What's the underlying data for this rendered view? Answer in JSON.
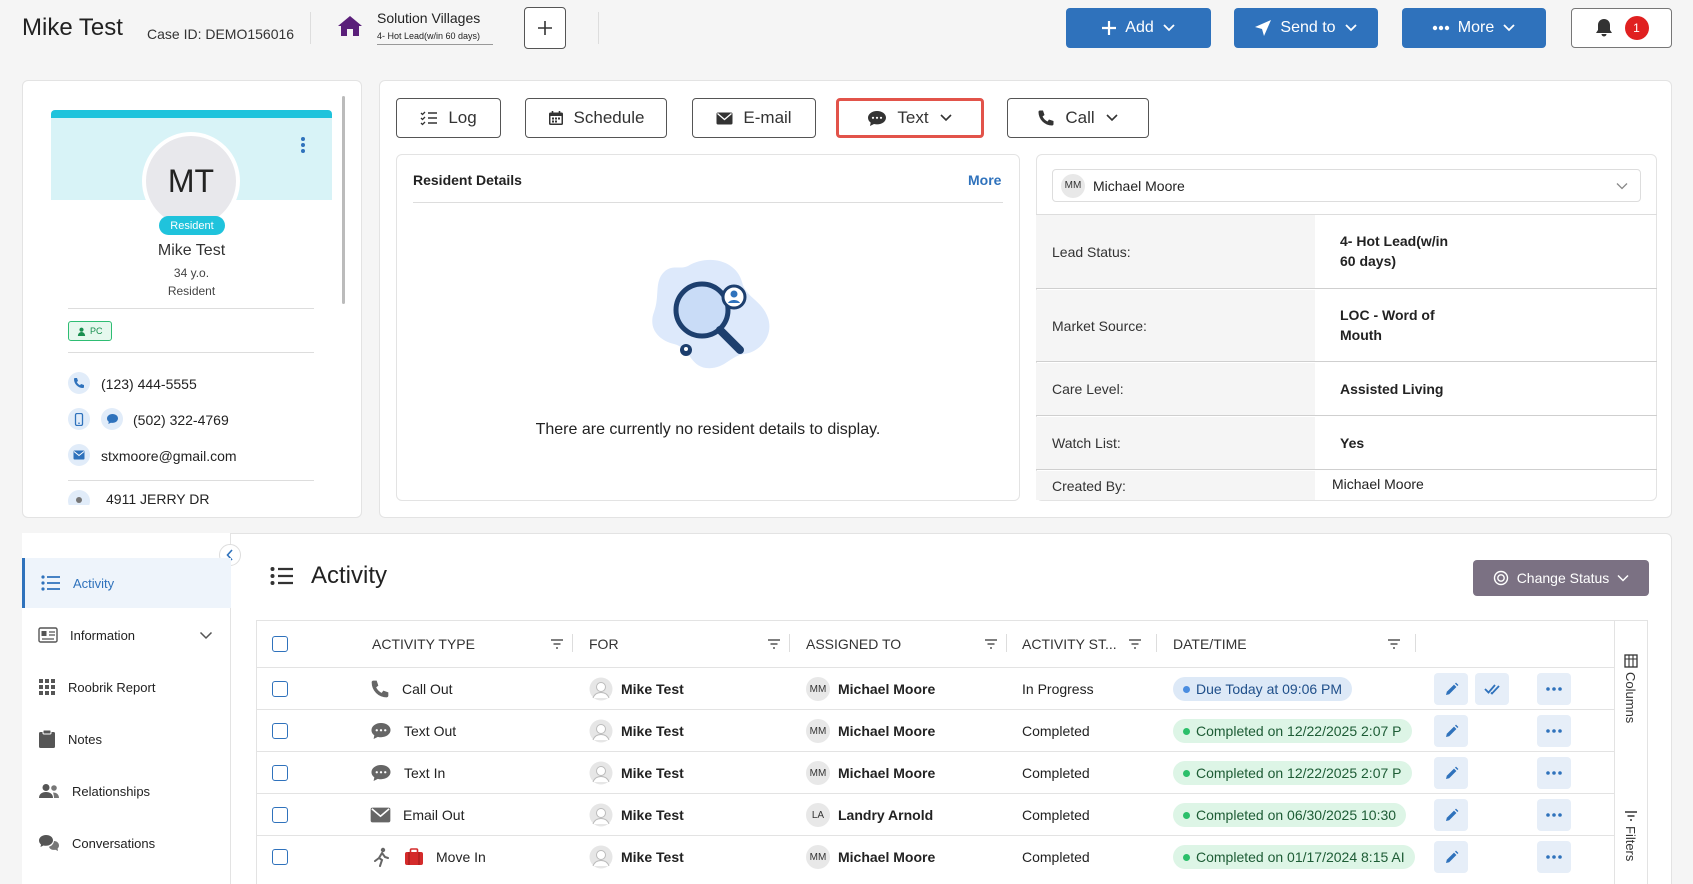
{
  "header": {
    "title": "Mike Test",
    "case_id": "Case ID: DEMO156016",
    "community_name": "Solution Villages",
    "community_status": "4- Hot Lead(w/in 60 days)",
    "add_label": "Add",
    "send_label": "Send to",
    "more_label": "More",
    "notification_count": "1"
  },
  "profile": {
    "initials": "MT",
    "badge": "Resident",
    "name": "Mike Test",
    "age": "34 y.o.",
    "role": "Resident",
    "tag": "PC",
    "phone": "(123) 444-5555",
    "mobile": "(502) 322-4769",
    "email": "stxmoore@gmail.com",
    "address": "4911 JERRY DR"
  },
  "actions": {
    "log": "Log",
    "schedule": "Schedule",
    "email": "E-mail",
    "text": "Text",
    "call": "Call"
  },
  "resident_details": {
    "title": "Resident Details",
    "more": "More",
    "empty": "There are currently no resident details to display."
  },
  "lead": {
    "user_initials": "MM",
    "user_name": "Michael Moore",
    "rows": [
      {
        "label": "Lead Status:",
        "value_line1": "4- Hot Lead(w/in",
        "value_line2": "60 days)"
      },
      {
        "label": "Market Source:",
        "value_line1": "LOC - Word of",
        "value_line2": "Mouth"
      },
      {
        "label": "Care Level:",
        "value_line1": "Assisted Living",
        "value_line2": ""
      },
      {
        "label": "Watch List:",
        "value_line1": "Yes",
        "value_line2": ""
      },
      {
        "label": "Created By:",
        "value_line1": "Michael Moore",
        "value_line2": ""
      }
    ]
  },
  "nav": {
    "items": [
      {
        "label": "Activity"
      },
      {
        "label": "Information"
      },
      {
        "label": "Roobrik Report"
      },
      {
        "label": "Notes"
      },
      {
        "label": "Relationships"
      },
      {
        "label": "Conversations"
      }
    ]
  },
  "activity": {
    "title": "Activity",
    "change_status": "Change Status",
    "columns": [
      "ACTIVITY TYPE",
      "FOR",
      "ASSIGNED TO",
      "ACTIVITY ST...",
      "DATE/TIME"
    ],
    "side_columns": "Columns",
    "side_filters": "Filters",
    "rows": [
      {
        "type": "Call Out",
        "for": "Mike Test",
        "assigned_initials": "MM",
        "assigned": "Michael Moore",
        "status": "In Progress",
        "date": "Due Today at 09:06 PM",
        "pill": "blue"
      },
      {
        "type": "Text Out",
        "for": "Mike Test",
        "assigned_initials": "MM",
        "assigned": "Michael Moore",
        "status": "Completed",
        "date": "Completed on 12/22/2025 2:07 P",
        "pill": "green"
      },
      {
        "type": "Text In",
        "for": "Mike Test",
        "assigned_initials": "MM",
        "assigned": "Michael Moore",
        "status": "Completed",
        "date": "Completed on 12/22/2025 2:07 P",
        "pill": "green"
      },
      {
        "type": "Email Out",
        "for": "Mike Test",
        "assigned_initials": "LA",
        "assigned": "Landry Arnold",
        "status": "Completed",
        "date": "Completed on 06/30/2025 10:30",
        "pill": "green"
      },
      {
        "type": "Move In",
        "for": "Mike Test",
        "assigned_initials": "MM",
        "assigned": "Michael Moore",
        "status": "Completed",
        "date": "Completed on 01/17/2024 8:15 AI",
        "pill": "green"
      }
    ]
  },
  "colors": {
    "primary": "#2f72bc",
    "resident_cyan": "#1fc3dc",
    "highlight_red": "#e2534a",
    "change_status": "#7b7183"
  }
}
